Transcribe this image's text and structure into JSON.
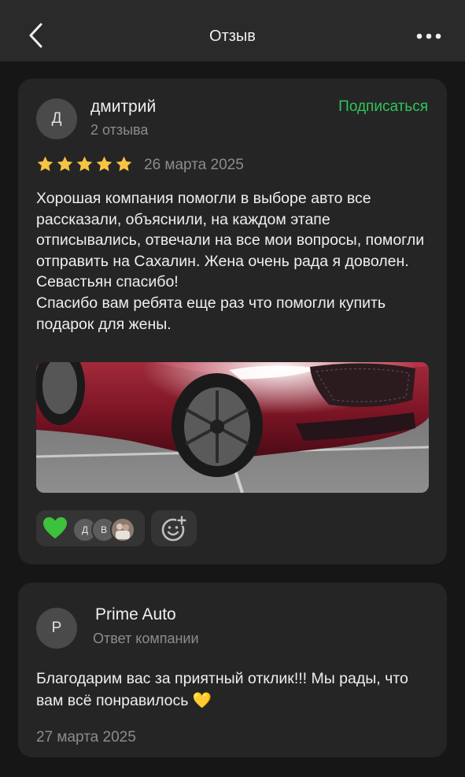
{
  "header": {
    "title": "Отзыв",
    "back_icon": "chevron-left-icon",
    "more_icon": "more-horizontal-icon"
  },
  "review": {
    "author": {
      "initial": "Д",
      "name": "дмитрий",
      "meta": "2 отзыва"
    },
    "subscribe_label": "Подписаться",
    "rating": 5,
    "rating_max": 5,
    "date": "26 марта 2025",
    "text": "Хорошая компания помогли в выборе авто все рассказали, объяснили, на каждом этапе отписывались, отвечали на все мои вопросы, помогли отправить на Сахалин. Жена очень рада я доволен. Севастьян спасибо!\nСпасибо вам ребята еще раз что помогли купить подарок для жены.",
    "photo_icon": "car-photo",
    "reactions": {
      "emoji_icon": "green-heart-icon",
      "avatars": [
        "Д",
        "В"
      ]
    },
    "add_reaction_icon": "add-reaction-icon"
  },
  "reply": {
    "author": {
      "initial": "P",
      "name": "Prime Auto",
      "meta": "Ответ компании"
    },
    "text": "Благодарим вас за приятный отклик!!! Мы рады, что вам всё понравилось 💛",
    "date": "27 марта 2025"
  },
  "colors": {
    "background": "#161616",
    "card": "#252525",
    "header": "#2a2a2a",
    "accent_green": "#2fc55c",
    "star": "#f6c343",
    "muted_text": "#8c8c8c"
  }
}
